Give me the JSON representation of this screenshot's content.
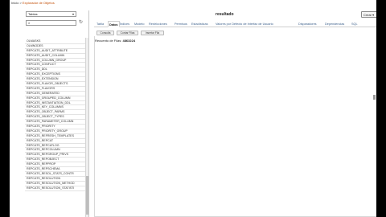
{
  "breadcrumb": {
    "prefix": "Inicio",
    "sep": " > ",
    "link": "Explorador de Objetos"
  },
  "left": {
    "type_select": "Tablas",
    "search_placeholder": "",
    "tables": [
      "OLMASKS",
      "OLMNODES",
      "REPCATS_AUDIT_ATTRIBUTE",
      "REPCATS_AUDIT_COLUMN",
      "REPCATS_COLUMN_GROUP",
      "REPCATS_CONFLICT",
      "REPCATS_DDL",
      "REPCATS_EXCEPTIONS",
      "REPCATS_EXTENSION",
      "REPCATS_FLAVOR_OBJECTS",
      "REPCATS_FLAVORS",
      "REPCATS_GENERATED",
      "REPCATS_GROUPED_COLUMN",
      "REPCATS_INSTANTIATION_DDL",
      "REPCATS_KEY_COLUMNS",
      "REPCATS_OBJECT_PARMS",
      "REPCATS_OBJECT_TYPES",
      "REPCATS_PARAMETER_COLUMN",
      "REPCATS_PRIORITY",
      "REPCATS_PRIORITY_GROUP",
      "REPCATS_REFRESH_TEMPLATES",
      "REPCATS_REPCAT",
      "REPCATS_REPCATLOG",
      "REPCATS_REPCOLUMN",
      "REPCATS_REPGROUP_PRIVS",
      "REPCATS_REPOBJECT",
      "REPCATS_REPPROP",
      "REPCATS_REPSCHEMA",
      "REPCATS_RESOL_STATS_CONTR",
      "REPCATS_RESOLUTION",
      "REPCATS_RESOLUTION_METHOD",
      "REPCATS_RESOLUTION_STATISTI"
    ]
  },
  "right": {
    "title": "resultado",
    "create_button": "Crear",
    "tabs": [
      "Tabla",
      "Datos",
      "Índices",
      "Modelo",
      "Restricciones",
      "Permisos",
      "Estadísticas",
      "Valores por Defecto de Interfaz de Usuario",
      "Disparadores",
      "Dependencias",
      "SQL"
    ],
    "active_tab": "Datos",
    "toolbar": [
      "Consulta",
      "Contar Filas",
      "Insertar Fila"
    ],
    "count_label": "Recuento de Filas:",
    "count_value": "4863224"
  }
}
